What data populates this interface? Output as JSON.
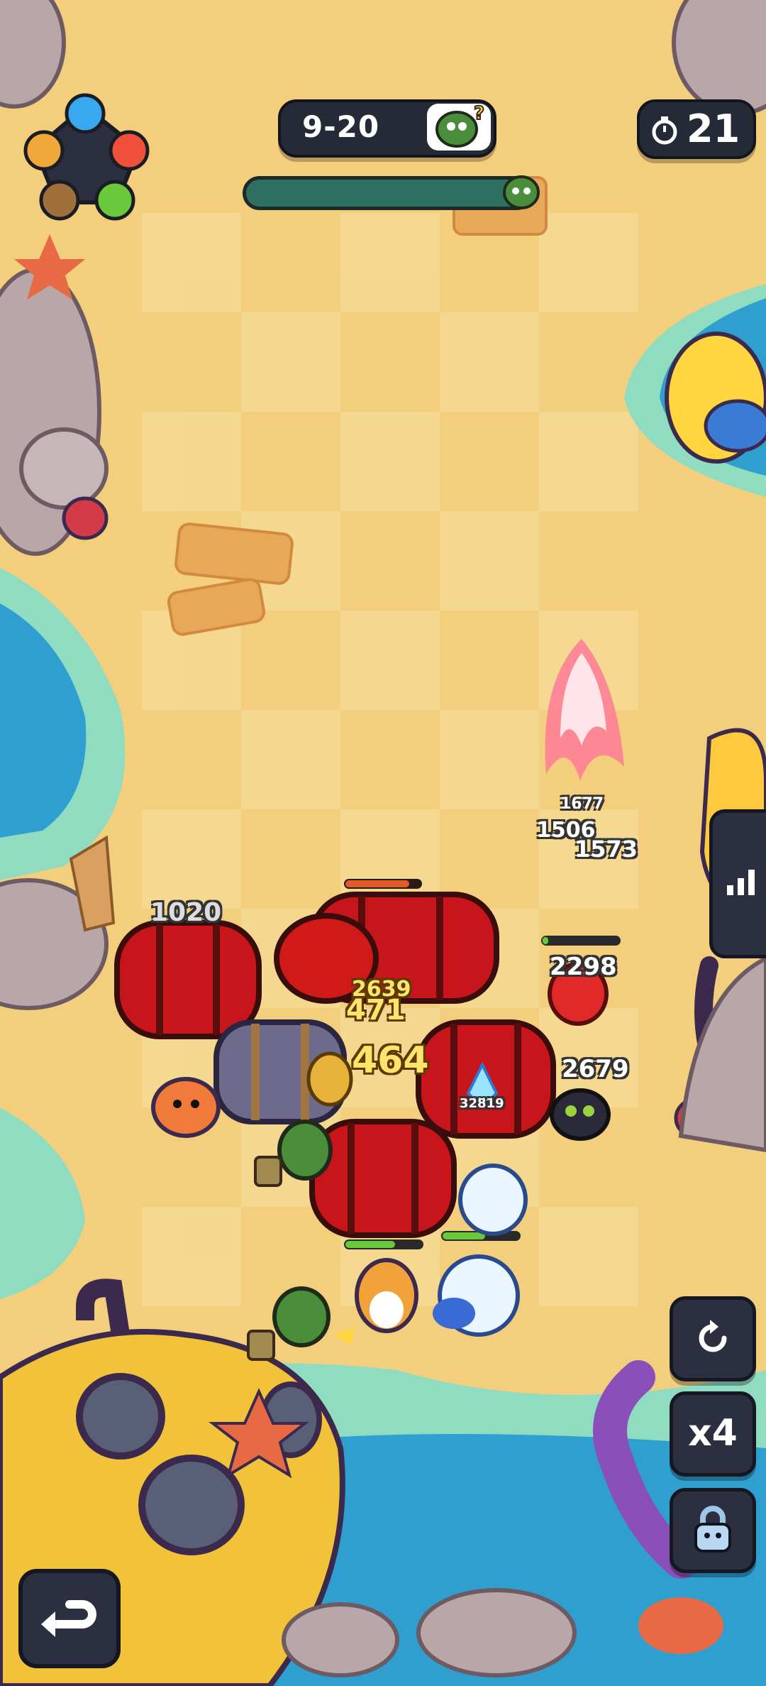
{
  "hud": {
    "stage": "9-20",
    "timer": "21",
    "element_wheel": [
      "water",
      "fire",
      "nature",
      "earth",
      "lightning"
    ]
  },
  "damage_numbers": {
    "d1020": "1020",
    "d1677": "1677",
    "d1506": "1506",
    "d1573": "1573",
    "d2298": "2298",
    "d2679": "2679",
    "d2639": "2639",
    "d471": "471",
    "d464": "464",
    "d32819": "32819"
  },
  "controls": {
    "speed_label": "x4"
  },
  "colors": {
    "sand": "#f3cf7d",
    "hud_dark": "#242a36",
    "progress_fill": "#2f6f62",
    "barrel_red": "#c8151b",
    "boss_hp": "#e05a2a"
  }
}
